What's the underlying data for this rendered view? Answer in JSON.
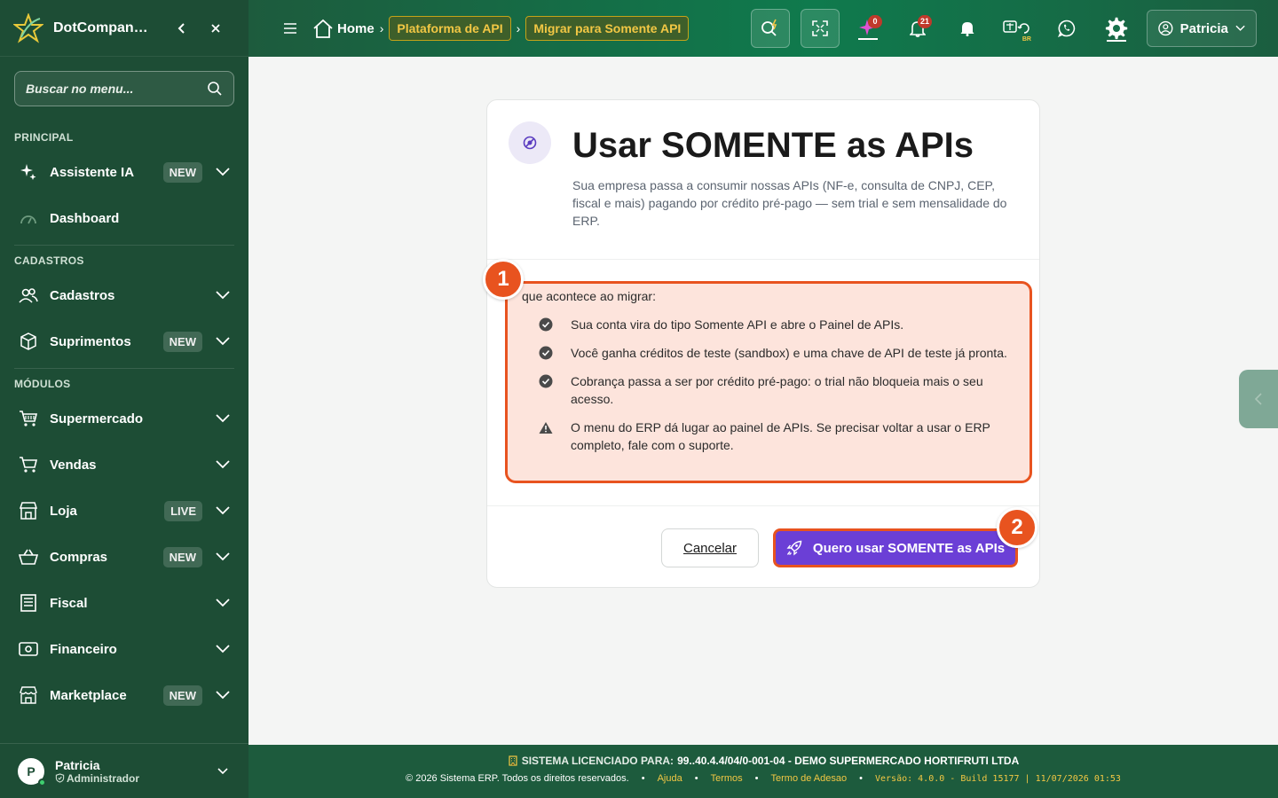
{
  "sidebar": {
    "brand": "DotCompan…",
    "search_placeholder": "Buscar no menu...",
    "sections": {
      "principal": "PRINCIPAL",
      "cadastros": "CADASTROS",
      "modulos": "MÓDULOS"
    },
    "items": [
      {
        "label": "Assistente IA",
        "badge": "NEW",
        "icon": "sparkles-icon"
      },
      {
        "label": "Dashboard",
        "badge": "",
        "icon": "gauge-icon"
      },
      {
        "label": "Cadastros",
        "badge": "",
        "icon": "users-icon"
      },
      {
        "label": "Suprimentos",
        "badge": "NEW",
        "icon": "box-icon"
      },
      {
        "label": "Supermercado",
        "badge": "",
        "icon": "cart-icon"
      },
      {
        "label": "Vendas",
        "badge": "",
        "icon": "cart-outline-icon"
      },
      {
        "label": "Loja",
        "badge": "LIVE",
        "icon": "store-icon"
      },
      {
        "label": "Compras",
        "badge": "NEW",
        "icon": "basket-icon"
      },
      {
        "label": "Fiscal",
        "badge": "",
        "icon": "receipt-icon"
      },
      {
        "label": "Financeiro",
        "badge": "",
        "icon": "cash-icon"
      },
      {
        "label": "Marketplace",
        "badge": "NEW",
        "icon": "shop-icon"
      }
    ],
    "user": {
      "initial": "P",
      "name": "Patricia",
      "role": "Administrador"
    }
  },
  "topbar": {
    "home": "Home",
    "crumbs": [
      "Plataforma de API",
      "Migrar para Somente API"
    ],
    "ai_count": "0",
    "notif_count": "21",
    "lang_label": "BR",
    "user": "Patricia"
  },
  "card": {
    "title": "Usar SOMENTE as APIs",
    "description": "Sua empresa passa a consumir nossas APIs (NF-e, consulta de CNPJ, CEP, fiscal e mais) pagando por crédito pré-pago — sem trial e sem mensalidade do ERP.",
    "info_title": "que acontece ao migrar:",
    "info_items": [
      {
        "icon": "check-circle-icon",
        "text": "Sua conta vira do tipo Somente API e abre o Painel de APIs."
      },
      {
        "icon": "check-circle-icon",
        "text": "Você ganha créditos de teste (sandbox) e uma chave de API de teste já pronta."
      },
      {
        "icon": "check-circle-icon",
        "text": "Cobrança passa a ser por crédito pré-pago: o trial não bloqueia mais o seu acesso."
      },
      {
        "icon": "warning-icon",
        "text": "O menu do ERP dá lugar ao painel de APIs. Se precisar voltar a usar o ERP completo, fale com o suporte."
      }
    ],
    "cancel_label": "Cancelar",
    "confirm_label": "Quero usar SOMENTE as APIs",
    "markers": [
      "1",
      "2"
    ]
  },
  "footer": {
    "license_label": "SISTEMA LICENCIADO PARA:",
    "license_value": "99..40.4.4/04/0-001-04 - DEMO SUPERMERCADO HORTIFRUTI LTDA",
    "copyright": "© 2026 Sistema ERP. Todos os direitos reservados.",
    "links": [
      "Ajuda",
      "Termos",
      "Termo de Adesao"
    ],
    "version": "Versão: 4.0.0 - Build 15177 | 11/07/2026 01:53"
  },
  "colors": {
    "sidebar_bg": "#1d4d35",
    "accent_gold": "#f2c744",
    "primary_purple": "#6b3fd6",
    "highlight_orange": "#e8531f"
  }
}
